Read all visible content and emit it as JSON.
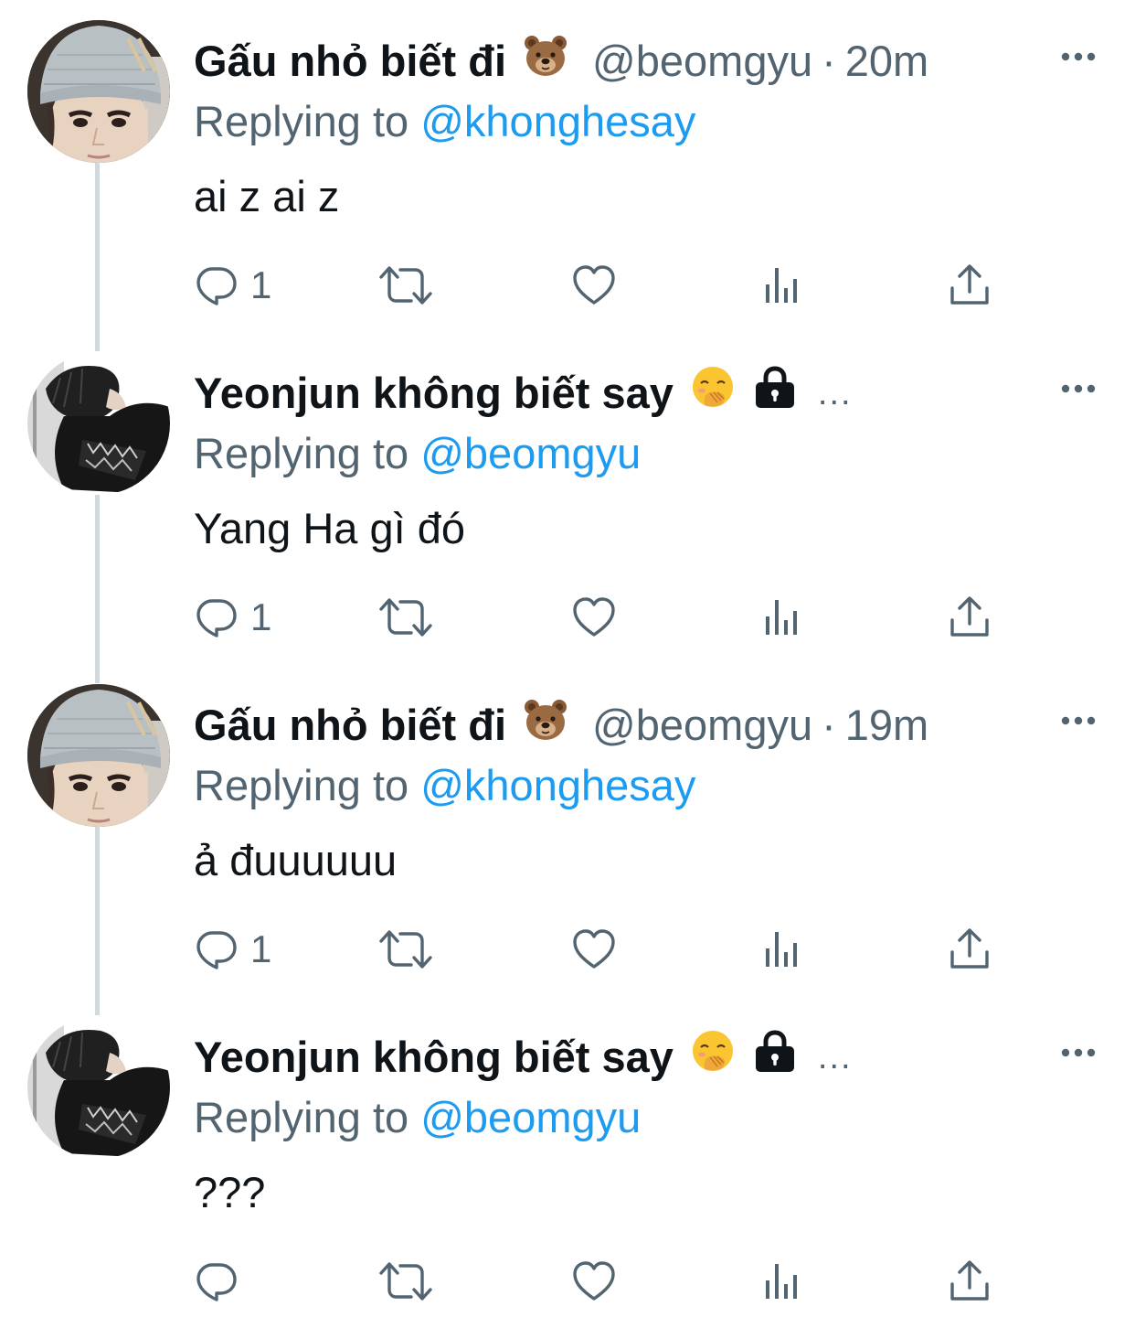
{
  "tweets": [
    {
      "name": "Gấu nhỏ biết đi",
      "name_emoji": "bear-face-emoji",
      "handle": "@beomgyu",
      "separator": "·",
      "time": "20m",
      "replying_prefix": "Replying to",
      "replying_handle": "@khonghesay",
      "text": "ai z ai z",
      "reply_count": "1",
      "avatar": "beanie-avatar"
    },
    {
      "name": "Yeonjun không biết say",
      "name_emoji": "face-with-hand-over-mouth-emoji",
      "lock_icon": "lock-icon",
      "truncation": "...",
      "replying_prefix": "Replying to",
      "replying_handle": "@beomgyu",
      "text": "Yang Ha gì đó",
      "reply_count": "1",
      "avatar": "dark-jacket-avatar"
    },
    {
      "name": "Gấu nhỏ biết đi",
      "name_emoji": "bear-face-emoji",
      "handle": "@beomgyu",
      "separator": "·",
      "time": "19m",
      "replying_prefix": "Replying to",
      "replying_handle": "@khonghesay",
      "text": "ả đuuuuuu",
      "reply_count": "1",
      "avatar": "beanie-avatar"
    },
    {
      "name": "Yeonjun không biết say",
      "name_emoji": "face-with-hand-over-mouth-emoji",
      "lock_icon": "lock-icon",
      "truncation": "...",
      "replying_prefix": "Replying to",
      "replying_handle": "@beomgyu",
      "text": "???",
      "reply_count": "",
      "avatar": "dark-jacket-avatar"
    }
  ],
  "actions": [
    "reply-icon",
    "retweet-icon",
    "like-icon",
    "analytics-icon",
    "share-icon"
  ],
  "colors": {
    "text_primary": "#0f1419",
    "text_secondary": "#536471",
    "link": "#1d9bf0",
    "thread_line": "#cfd9de",
    "background": "#ffffff"
  }
}
